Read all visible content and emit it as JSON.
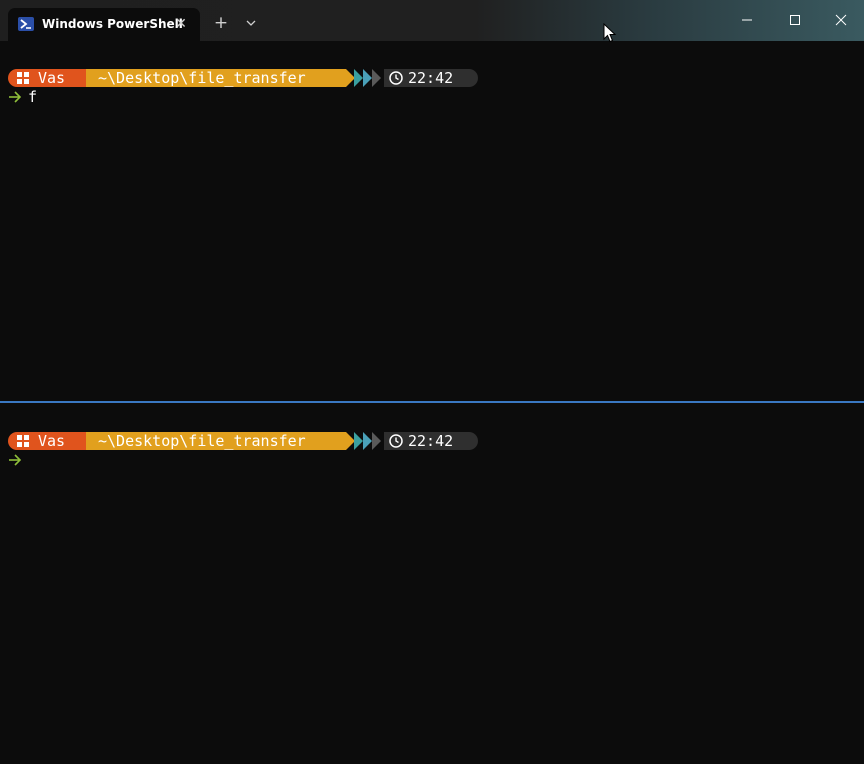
{
  "window": {
    "tab_title": "Windows PowerShell",
    "close_tab_glyph": "✕",
    "new_tab_glyph": "+",
    "icons": {
      "tab": "powershell-icon",
      "dropdown": "chevron-down-icon",
      "minimize": "minimize-icon",
      "maximize": "maximize-icon",
      "close": "close-icon"
    }
  },
  "colors": {
    "terminal_bg": "#0c0c0c",
    "user_segment": "#e0541d",
    "path_segment": "#e1a01e",
    "chevron_1": "#3aa0a0",
    "chevron_2": "#4aa0b8",
    "chevron_3": "#5a5a5a",
    "time_segment": "#2f2f2f",
    "prompt_arrow": "#8fbf3a",
    "pane_divider": "#3a78c2"
  },
  "panes": [
    {
      "prompt": {
        "user": "Vas",
        "path": "~\\Desktop\\file_transfer",
        "time": "22:42"
      },
      "input": "f"
    },
    {
      "prompt": {
        "user": "Vas",
        "path": "~\\Desktop\\file_transfer",
        "time": "22:42"
      },
      "input": ""
    }
  ]
}
